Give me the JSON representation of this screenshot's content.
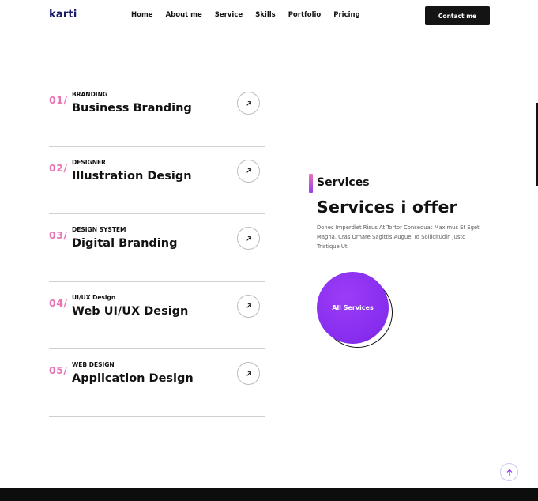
{
  "header": {
    "logo": "karti",
    "nav": [
      "Home",
      "About me",
      "Service",
      "Skills",
      "Portfolio",
      "Pricing"
    ],
    "contact_label": "Contact me"
  },
  "services": [
    {
      "num": "01/",
      "category": "BRANDING",
      "title": "Business Branding"
    },
    {
      "num": "02/",
      "category": "DESIGNER",
      "title": "Illustration Design"
    },
    {
      "num": "03/",
      "category": "DESIGN SYSTEM",
      "title": "Digital Branding"
    },
    {
      "num": "04/",
      "category": "UI/UX Design",
      "title": "Web UI/UX Design"
    },
    {
      "num": "05/",
      "category": "WEB DESIGN",
      "title": "Application Design"
    }
  ],
  "section": {
    "label": "Services",
    "heading": "Services i offer",
    "description": "Donec Imperdiet Risus At Tortor Consequat Maximus Et Eget Magna. Cras Ornare Sagittis Augue, Id Sollicitudin Justo Tristique Ut.",
    "all_button": "All Services"
  },
  "colors": {
    "accent_purple": "#8a2ff0",
    "accent_pink": "#e873b6",
    "dark": "#141414"
  },
  "icons": {
    "service_arrow": "arrow-up-right-icon",
    "back_to_top": "arrow-up-icon"
  }
}
